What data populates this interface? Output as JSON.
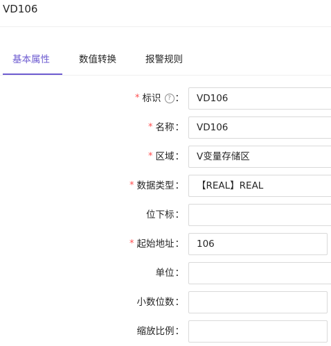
{
  "header": {
    "title": "VD106"
  },
  "tabs": [
    {
      "label": "基本属性",
      "active": true
    },
    {
      "label": "数值转换",
      "active": false
    },
    {
      "label": "报警规则",
      "active": false
    }
  ],
  "form": {
    "fields": [
      {
        "label": "标识",
        "required": true,
        "help": true,
        "value": "VD106"
      },
      {
        "label": "名称",
        "required": true,
        "help": false,
        "value": "VD106"
      },
      {
        "label": "区域",
        "required": true,
        "help": false,
        "value": "V变量存储区"
      },
      {
        "label": "数据类型",
        "required": true,
        "help": false,
        "value": "【REAL】REAL"
      },
      {
        "label": "位下标",
        "required": false,
        "help": false,
        "value": ""
      },
      {
        "label": "起始地址",
        "required": true,
        "help": false,
        "value": "106"
      },
      {
        "label": "单位",
        "required": false,
        "help": false,
        "value": ""
      },
      {
        "label": "小数位数",
        "required": false,
        "help": false,
        "value": ""
      },
      {
        "label": "缩放比例",
        "required": false,
        "help": false,
        "value": ""
      }
    ],
    "colon": "：",
    "required_mark": "*",
    "help_icon": "?"
  },
  "colors": {
    "accent": "#6d5bd0",
    "required": "#ff4d4f",
    "border": "#d9d9d9"
  }
}
